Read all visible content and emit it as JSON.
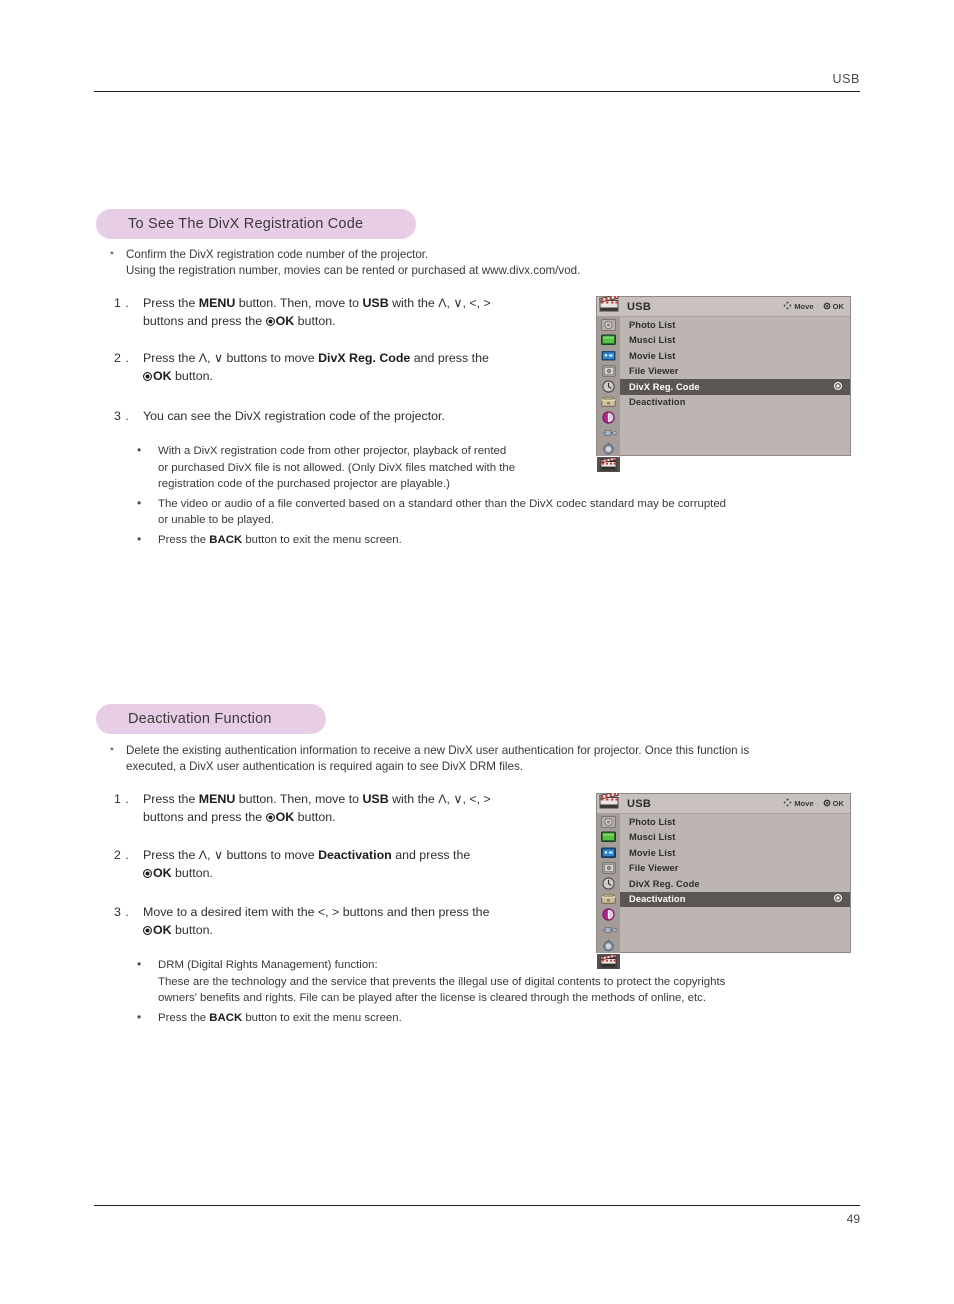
{
  "header": {
    "title": "USB"
  },
  "footer": {
    "page_number": "49"
  },
  "sections": [
    {
      "heading": "To See The DivX Registration Code",
      "note_star": "*",
      "note_line1": "Confirm the DivX registration code number of the projector.",
      "note_line2": "Using the registration number, movies can be rented or purchased at www.divx.com/vod.",
      "steps": [
        {
          "num": "1 .",
          "l1_a": "Press the ",
          "l1_b": "MENU",
          "l1_c": " button. Then, move to ",
          "l1_d": "USB",
          "l1_e": " with the Λ, ∨, <, >",
          "l2_a": "buttons and press the ",
          "l2_b": "OK",
          "l2_c": " button."
        },
        {
          "num": "2 .",
          "l1_a": "Press the Λ, ∨ buttons to move ",
          "l1_b": "DivX Reg. Code",
          "l1_c": " and press the",
          "l2_b": "OK",
          "l2_c": " button."
        },
        {
          "num": "3 .",
          "l1_a": "You can see the DivX registration code of the projector."
        }
      ],
      "bullets": [
        {
          "lines": [
            "With a DivX registration code from other projector, playback of rented",
            "or purchased DivX file is not allowed. (Only DivX files matched with the",
            "registration code of the purchased projector are playable.)"
          ]
        },
        {
          "lines": [
            "The video or audio of a file converted based on a standard other than the DivX codec standard may be corrupted",
            "or unable to be played."
          ]
        },
        {
          "pre": "Press the ",
          "strong": "BACK",
          "post": " button to exit the menu screen."
        }
      ]
    },
    {
      "heading": "Deactivation Function",
      "note_star": "*",
      "note_line1": "Delete the existing authentication information to receive a new DivX user authentication for projector. Once this function is",
      "note_line2": "executed, a DivX user authentication is required again to see DivX DRM files.",
      "steps": [
        {
          "num": "1 .",
          "l1_a": "Press the ",
          "l1_b": "MENU",
          "l1_c": " button. Then, move to ",
          "l1_d": "USB",
          "l1_e": " with the Λ, ∨, <, >",
          "l2_a": "buttons and press the ",
          "l2_b": "OK",
          "l2_c": " button."
        },
        {
          "num": "2 .",
          "l1_a": "Press the Λ, ∨  buttons to move ",
          "l1_b": "Deactivation",
          "l1_c": " and press the",
          "l2_b": "OK",
          "l2_c": " button."
        },
        {
          "num": "3 .",
          "l1_a": "Move to a desired item with the <, >  buttons and then press the",
          "l2_b": "OK",
          "l2_c": " button."
        }
      ],
      "bullets": [
        {
          "lines": [
            "DRM (Digital Rights Management) function:",
            "These are the technology and the service that prevents the illegal use of digital contents to protect the copyrights",
            "owners' benefits and rights. File can be played after the license is cleared through the methods of online, etc."
          ]
        },
        {
          "pre": "Press the ",
          "strong": "BACK",
          "post": " button to exit the menu screen."
        }
      ]
    }
  ],
  "osd": {
    "title": "USB",
    "hint_move": "Move",
    "hint_ok": "OK",
    "items": [
      {
        "label": "Photo List",
        "icon": "photo-list-icon"
      },
      {
        "label": "Musci List",
        "icon": "music-list-icon"
      },
      {
        "label": "Movie List",
        "icon": "movie-list-icon"
      },
      {
        "label": "File Viewer",
        "icon": "file-viewer-icon"
      },
      {
        "label": "DivX Reg. Code",
        "icon": "divx-reg-code-icon"
      },
      {
        "label": "Deactivation",
        "icon": "deactivation-icon"
      }
    ],
    "side_icons": [
      "picture-icon",
      "audio-icon",
      "time-icon",
      "option-icon",
      "usb-icon"
    ],
    "selected_first": "DivX Reg. Code",
    "selected_second": "Deactivation",
    "colors": {
      "menu_bg": "#bdb5b2",
      "title_bg": "#c8c1be",
      "icon_col_bg": "#a49c99",
      "highlight": "#5b5654",
      "pill": "#e7cee6"
    }
  }
}
